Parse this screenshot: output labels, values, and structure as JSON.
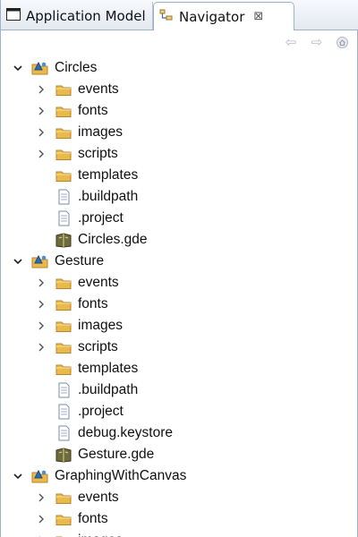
{
  "tabs": [
    {
      "label": "Application Model"
    },
    {
      "label": "Navigator"
    }
  ],
  "tree": [
    {
      "label": "Circles",
      "level": 0,
      "type": "project",
      "expander": "expanded"
    },
    {
      "label": "events",
      "level": 1,
      "type": "folder",
      "expander": "collapsed"
    },
    {
      "label": "fonts",
      "level": 1,
      "type": "folder",
      "expander": "collapsed"
    },
    {
      "label": "images",
      "level": 1,
      "type": "folder",
      "expander": "collapsed"
    },
    {
      "label": "scripts",
      "level": 1,
      "type": "folder",
      "expander": "collapsed"
    },
    {
      "label": "templates",
      "level": 1,
      "type": "folder",
      "expander": "none"
    },
    {
      "label": ".buildpath",
      "level": 1,
      "type": "file",
      "expander": "none"
    },
    {
      "label": ".project",
      "level": 1,
      "type": "file",
      "expander": "none"
    },
    {
      "label": "Circles.gde",
      "level": 1,
      "type": "gde",
      "expander": "none"
    },
    {
      "label": "Gesture",
      "level": 0,
      "type": "project",
      "expander": "expanded"
    },
    {
      "label": "events",
      "level": 1,
      "type": "folder",
      "expander": "collapsed"
    },
    {
      "label": "fonts",
      "level": 1,
      "type": "folder",
      "expander": "collapsed"
    },
    {
      "label": "images",
      "level": 1,
      "type": "folder",
      "expander": "collapsed"
    },
    {
      "label": "scripts",
      "level": 1,
      "type": "folder",
      "expander": "collapsed"
    },
    {
      "label": "templates",
      "level": 1,
      "type": "folder",
      "expander": "none"
    },
    {
      "label": ".buildpath",
      "level": 1,
      "type": "file",
      "expander": "none"
    },
    {
      "label": ".project",
      "level": 1,
      "type": "file",
      "expander": "none"
    },
    {
      "label": "debug.keystore",
      "level": 1,
      "type": "file",
      "expander": "none"
    },
    {
      "label": "Gesture.gde",
      "level": 1,
      "type": "gde",
      "expander": "none"
    },
    {
      "label": "GraphingWithCanvas",
      "level": 0,
      "type": "project",
      "expander": "expanded"
    },
    {
      "label": "events",
      "level": 1,
      "type": "folder",
      "expander": "collapsed"
    },
    {
      "label": "fonts",
      "level": 1,
      "type": "folder",
      "expander": "collapsed"
    },
    {
      "label": "images",
      "level": 1,
      "type": "folder",
      "expander": "collapsed"
    }
  ],
  "colors": {
    "folder": "#e9b94a",
    "folder_edge": "#b8862a",
    "accent_border": "#9fb2c7"
  }
}
